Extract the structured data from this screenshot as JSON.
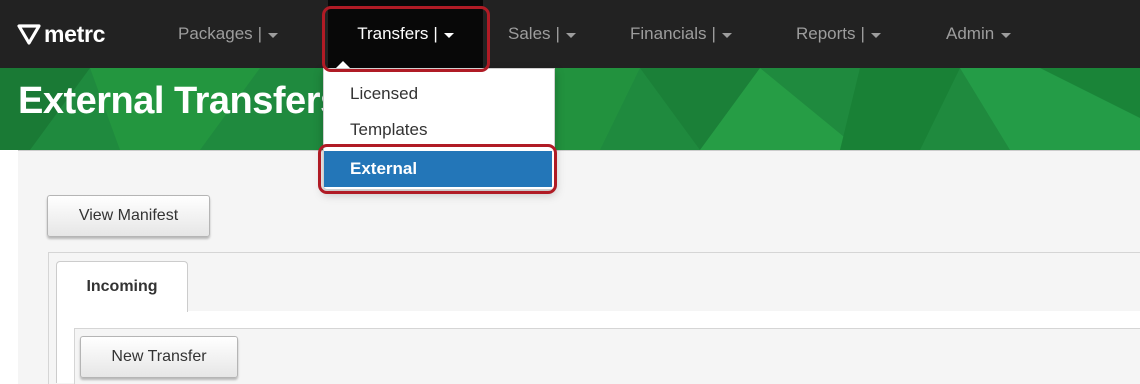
{
  "app": {
    "logo_text": "metrc"
  },
  "nav": {
    "items": [
      {
        "label": "Packages",
        "separator": "|"
      },
      {
        "label": "Transfers",
        "separator": "|"
      },
      {
        "label": "Sales",
        "separator": "|"
      },
      {
        "label": "Financials",
        "separator": "|"
      },
      {
        "label": "Reports",
        "separator": "|"
      },
      {
        "label": "Admin"
      }
    ],
    "active": "Transfers"
  },
  "dropdown": {
    "items": [
      {
        "label": "Licensed"
      },
      {
        "label": "Templates"
      },
      {
        "label": "External"
      }
    ],
    "selected": "External"
  },
  "page": {
    "title": "External Transfers"
  },
  "toolbar": {
    "view_manifest_label": "View Manifest"
  },
  "tabs": [
    {
      "label": "Incoming"
    }
  ],
  "actions": {
    "new_transfer_label": "New Transfer"
  },
  "colors": {
    "navbar": "#222222",
    "header_green": "#1f8a3e",
    "selected_item": "#2376b8",
    "highlight_outline": "#b01b25"
  }
}
